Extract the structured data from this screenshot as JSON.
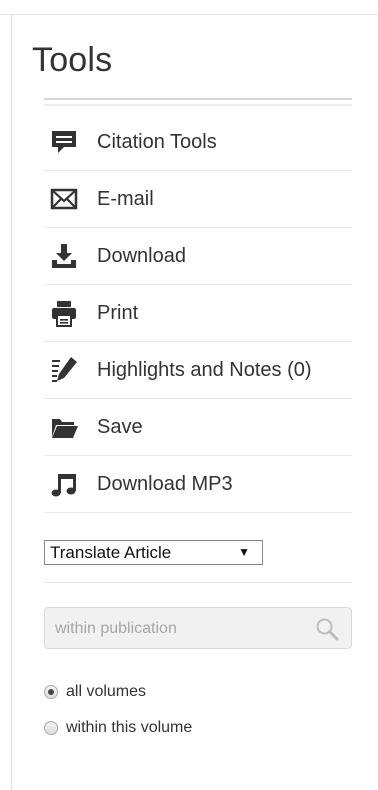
{
  "title": "Tools",
  "tools": [
    {
      "label": "Citation Tools",
      "icon": "citation-comment-icon"
    },
    {
      "label": "E-mail",
      "icon": "envelope-icon"
    },
    {
      "label": "Download",
      "icon": "download-icon"
    },
    {
      "label": "Print",
      "icon": "printer-icon"
    },
    {
      "label": "Highlights and Notes (0)",
      "icon": "highlight-pen-icon"
    },
    {
      "label": "Save",
      "icon": "folder-icon"
    },
    {
      "label": "Download MP3",
      "icon": "music-note-icon"
    }
  ],
  "translate": {
    "selected": "Translate Article"
  },
  "search": {
    "placeholder": "within publication",
    "value": ""
  },
  "scope": {
    "options": [
      {
        "label": "all volumes",
        "checked": true
      },
      {
        "label": "within this volume",
        "checked": false
      }
    ]
  },
  "colors": {
    "icon": "#333333",
    "text": "#333333",
    "rule": "#e8e8e8"
  }
}
